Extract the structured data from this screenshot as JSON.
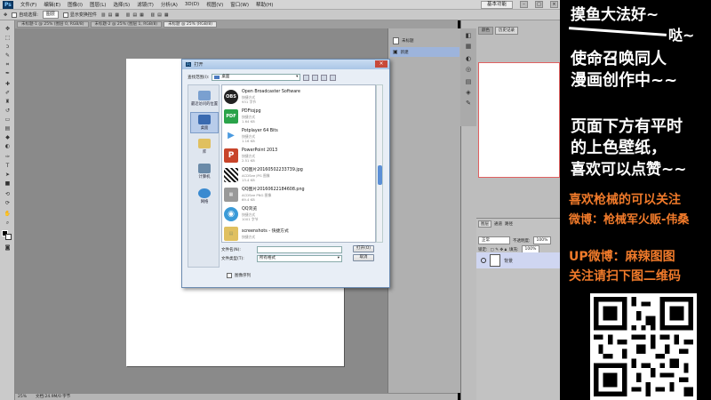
{
  "app": {
    "logo": "Ps",
    "menu": [
      "文件(F)",
      "编辑(E)",
      "图像(I)",
      "图层(L)",
      "选择(S)",
      "滤镜(T)",
      "分析(A)",
      "3D(D)",
      "视图(V)",
      "窗口(W)",
      "帮助(H)"
    ],
    "workspace": "基本功能"
  },
  "options": {
    "auto_select_label": "自动选择:",
    "auto_select_value": "图层",
    "transform_label": "显示变换控件"
  },
  "tabs": [
    "未标题-1 @ 25% (图层 0, RGB/8)",
    "未标题-2 @ 25% (图层 1, RGB/8)",
    "未标题 @ 25% (RGB/8)"
  ],
  "status": {
    "zoom": "25%",
    "doc": "文档:24.9M/0 字节"
  },
  "history": {
    "items": [
      "未标题",
      "新建"
    ]
  },
  "right_tabs": [
    "颜色",
    "历史记录"
  ],
  "layers": {
    "tabs": [
      "图层",
      "通道",
      "路径"
    ],
    "mode": "正常",
    "opacity_label": "不透明度:",
    "opacity": "100%",
    "lock_label": "锁定:",
    "fill_label": "填充:",
    "fill": "100%",
    "layer_name": "背景"
  },
  "dialog": {
    "title": "打开",
    "look_in_label": "查找范围(I):",
    "look_in": "桌面",
    "places": [
      "最近访问的位置",
      "桌面",
      "库",
      "计算机",
      "网络"
    ],
    "files": [
      {
        "name": "Open Broadcaster Software",
        "type": "快捷方式",
        "size": "931 字节",
        "icon": "OBS",
        "color": "#222"
      },
      {
        "name": "PDFtojpg",
        "type": "快捷方式",
        "size": "1.64 KB",
        "icon": "PDF",
        "color": "#2aa34a"
      },
      {
        "name": "Potplayer 64 Bits",
        "type": "快捷方式",
        "size": "1.16 KB",
        "icon": "▶",
        "color": "#8cc8f0"
      },
      {
        "name": "PowerPoint 2013",
        "type": "快捷方式",
        "size": "2.51 KB",
        "icon": "P",
        "color": "#c8442a"
      },
      {
        "name": "QQ图片20160502233739.jpg",
        "type": "ACDSee JPG 图像",
        "size": "13.4 KB",
        "icon": "QR",
        "color": "#555"
      },
      {
        "name": "QQ图片20160622184608.png",
        "type": "ACDSee PNG 图像",
        "size": "69.4 KB",
        "icon": "▦",
        "color": "#777"
      },
      {
        "name": "QQ浏览",
        "type": "快捷方式",
        "size": "1001 字节",
        "icon": "◉",
        "color": "#3a9ad8"
      },
      {
        "name": "screenshots - 快捷方式",
        "type": "快捷方式",
        "size": "",
        "icon": "▤",
        "color": "#e0c060"
      }
    ],
    "filename_label": "文件名(N):",
    "filename": "",
    "filetype_label": "文件类型(T):",
    "filetype": "所有格式",
    "open_btn": "打开(O)",
    "cancel_btn": "取消",
    "sequence_label": "图像序列"
  },
  "overlay": {
    "line1": "摸鱼大法好~",
    "line2": "哒~",
    "line3": "使命召唤同人",
    "line4": "漫画创作中~~",
    "line5": "页面下方有平时",
    "line6": "的上色壁纸，",
    "line7": "喜欢可以点赞~~",
    "line8": "喜欢枪械的可以关注",
    "line9": "微博：枪械军火贩-伟桑",
    "line10": "UP微博：麻辣图图",
    "line11": "关注请扫下图二维码",
    "colors": {
      "white": "#ffffff",
      "orange": "#f07a2a"
    }
  }
}
